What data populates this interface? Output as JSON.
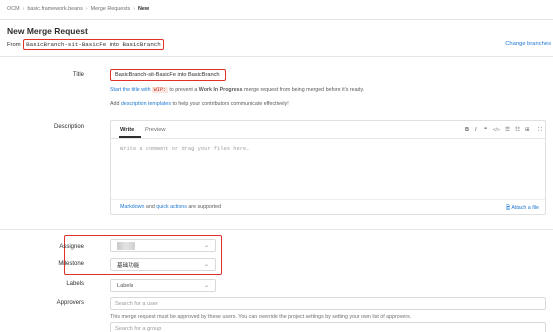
{
  "breadcrumb": {
    "items": [
      "OCM",
      "basic.framework.beans",
      "Merge Requests"
    ],
    "current": "New"
  },
  "page": {
    "title": "New Merge Request",
    "from_prefix": "From",
    "source_branch": "BasicBranch-sit-BasicFe",
    "into_word": "into",
    "target_branch": "BasicBranch",
    "change_branches_link": "Change branches"
  },
  "form": {
    "title_label": "Title",
    "title_value": "BasicBranch-sit-BasicFe into BasicBranch",
    "wip_hint": {
      "link_text": "Start the title with",
      "code": "WIP:",
      "middle": "to prevent a",
      "bold": "Work In Progress",
      "end": "merge request from being merged before it's ready."
    },
    "template_hint": {
      "prefix": "Add",
      "link_text": "description templates",
      "suffix": "to help your contributors communicate effectively!"
    },
    "description_label": "Description",
    "tabs": {
      "write": "Write",
      "preview": "Preview"
    },
    "toolbar": [
      {
        "icon": "bold-icon",
        "glyph": "B"
      },
      {
        "icon": "italic-icon",
        "glyph": "I"
      },
      {
        "icon": "quote-icon",
        "glyph": "❝"
      },
      {
        "icon": "code-icon",
        "glyph": "</>"
      },
      {
        "icon": "bullet-list-icon",
        "glyph": "☰"
      },
      {
        "icon": "numbered-list-icon",
        "glyph": "☷"
      },
      {
        "icon": "task-list-icon",
        "glyph": "⊞"
      },
      {
        "icon": "fullscreen-icon",
        "glyph": "⛶"
      }
    ],
    "description_placeholder": "Write a comment or drag your files here…",
    "markdown_footer": {
      "link1": "Markdown",
      "and": "and",
      "link2": "quick actions",
      "suffix": "are supported"
    },
    "attach_file": "Attach a file",
    "assignee_label": "Assignee",
    "milestone_label": "Milestone",
    "milestone_value": "基础功能",
    "labels_label": "Labels",
    "labels_value": "Labels",
    "approvers_label": "Approvers",
    "approvers_placeholder": "Search for a user",
    "approvers_hint": "This merge request must be approved by these users. You can override the project settings by setting your own list of approvers.",
    "group_placeholder": "Search for a group"
  },
  "colors": {
    "accent_link": "#1f78d1",
    "highlight_border": "#e0312b",
    "text": "#2e2e2e"
  }
}
